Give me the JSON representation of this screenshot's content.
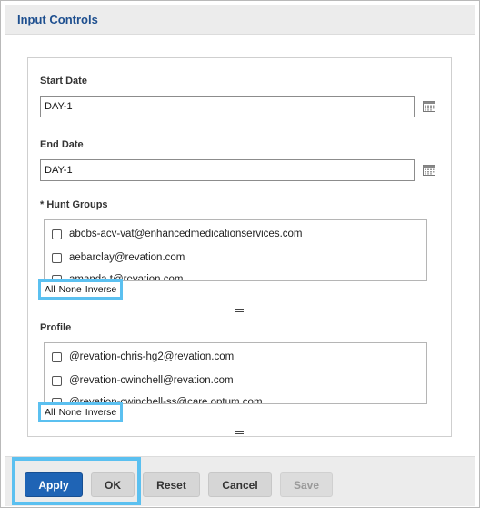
{
  "dialog": {
    "title": "Input Controls"
  },
  "start_date": {
    "label": "Start Date",
    "value": "DAY-1",
    "calendar_icon": "calendar-icon"
  },
  "end_date": {
    "label": "End Date",
    "value": "DAY-1",
    "calendar_icon": "calendar-icon"
  },
  "hunt_groups": {
    "label": "* Hunt Groups",
    "items": [
      "abcbs-acv-vat@enhancedmedicationservices.com",
      "aebarclay@revation.com",
      "amanda.t@revation.com"
    ],
    "select_all": "All",
    "select_none": "None",
    "select_inverse": "Inverse"
  },
  "profile": {
    "label": "Profile",
    "items": [
      "@revation-chris-hg2@revation.com",
      "@revation-cwinchell@revation.com",
      "@revation-cwinchell-ss@care.optum.com"
    ],
    "select_all": "All",
    "select_none": "None",
    "select_inverse": "Inverse"
  },
  "buttons": {
    "apply": "Apply",
    "ok": "OK",
    "reset": "Reset",
    "cancel": "Cancel",
    "save": "Save"
  },
  "colors": {
    "title": "#1e4f8f",
    "primary_button": "#1f64b5",
    "highlight": "#5bc0f0"
  }
}
